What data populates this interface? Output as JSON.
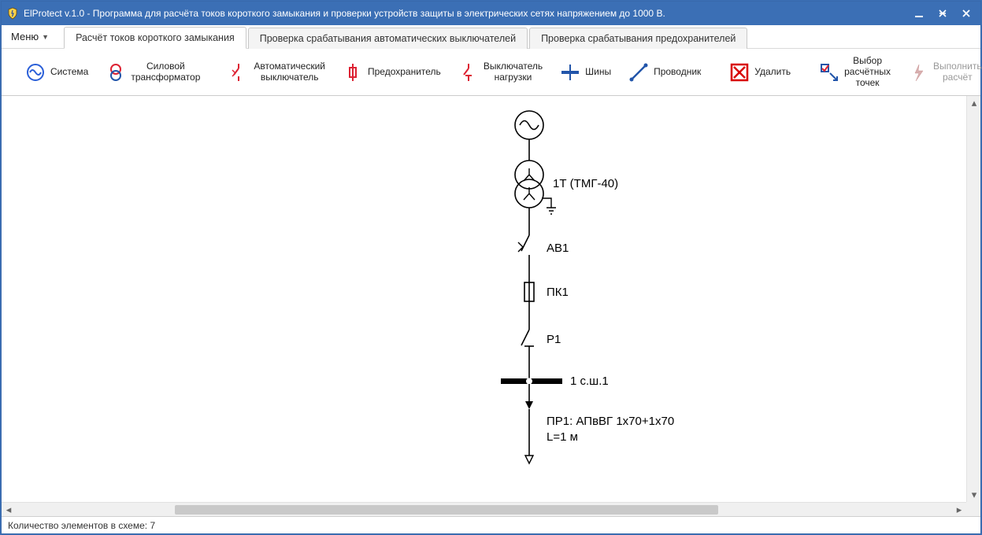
{
  "app": {
    "title": "ElProtect v.1.0 - Программа для расчёта токов короткого замыкания и проверки устройств защиты в электрических сетях напряжением до 1000 В."
  },
  "menu": {
    "label": "Меню"
  },
  "tabs": [
    {
      "label": "Расчёт токов короткого замыкания",
      "active": true
    },
    {
      "label": "Проверка срабатывания автоматических выключателей",
      "active": false
    },
    {
      "label": "Проверка срабатывания предохранителей",
      "active": false
    }
  ],
  "toolbar": {
    "system": "Система",
    "transformer": "Силовой трансформатор",
    "breaker": "Автоматический выключатель",
    "fuse": "Предохранитель",
    "load_switch": "Выключатель нагрузки",
    "bus": "Шины",
    "conductor": "Проводник",
    "delete": "Удалить",
    "points": "Выбор расчётных точек",
    "run": "Выполнить расчёт"
  },
  "diagram": {
    "transformer_label": "1Т (ТМГ-40)",
    "breaker_label": "АВ1",
    "fuse_label": "ПК1",
    "switch_label": "Р1",
    "bus_label": "1 с.ш.1",
    "cable_line1": "ПР1: АПвВГ 1x70+1x70",
    "cable_line2": "L=1 м"
  },
  "status": {
    "text": "Количество элементов в схеме: 7"
  }
}
